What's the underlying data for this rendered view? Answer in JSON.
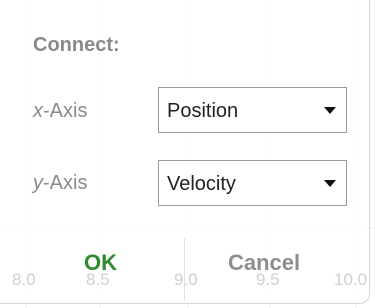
{
  "dialog": {
    "title": "Connect:",
    "x_axis": {
      "label_var": "x",
      "label_rest": "-Axis",
      "selected": "Position"
    },
    "y_axis": {
      "label_var": "y",
      "label_rest": "-Axis",
      "selected": "Velocity"
    },
    "ok_label": "OK",
    "cancel_label": "Cancel"
  },
  "background_axis": {
    "ticks": [
      "8.0",
      "8.5",
      "9.0",
      "9.5",
      "10.0"
    ]
  },
  "colors": {
    "ok": "#2e8b2e",
    "cancel": "#8e8e8e",
    "label": "#8a8a8a"
  }
}
